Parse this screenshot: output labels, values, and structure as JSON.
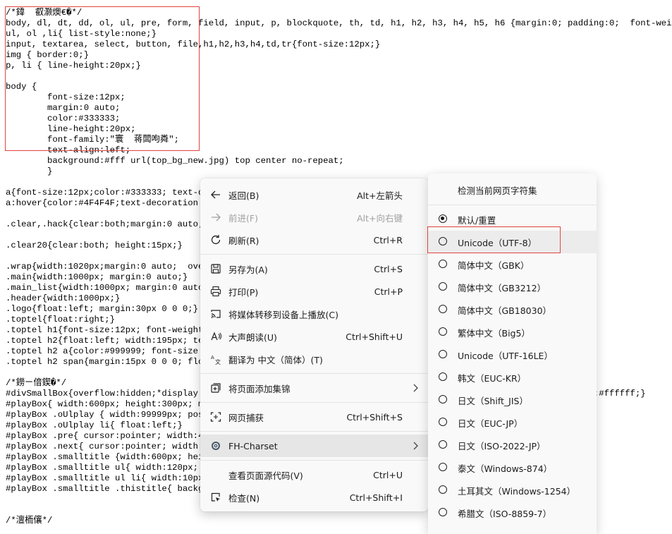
{
  "source_lines": [
    "/*鍏  叡灏燠€�*/",
    "body, dl, dt, dd, ol, ul, pre, form, field, input, p, blockquote, th, td, h1, h2, h3, h4, h5, h6 {margin:0; padding:0;  font-weight:",
    "ul, ol ,li{ list-style:none;}",
    "input, textarea, select, button, file,h1,h2,h3,h4,td,tr{font-size:12px;}",
    "img { border:0;}",
    "p, li { line-height:20px;}",
    "",
    "body {",
    "        font-size:12px;",
    "        margin:0 auto;",
    "        color:#333333;",
    "        line-height:20px;",
    "        font-family:\"寰  蒋闆呴粦\";",
    "        text-align:left;",
    "        background:#fff url(top_bg_new.jpg) top center no-repeat;",
    "        }",
    "",
    "a{font-size:12px;color:#333333; text-decoration:none;}",
    "a:hover{color:#4F4F4F;text-decoration: none;}",
    "",
    ".clear,.hack{clear:both;margin:0 auto;}",
    "",
    ".clear20{clear:both; height:15px;}",
    "",
    ".wrap{width:1020px;margin:0 auto;  overflow:hidden;}",
    ".main{width:1000px; margin:0 auto;}",
    ".main_list{width:1000px; margin:0 auto;background:#fff;}",
    ".header{width:1000px;}",
    ".logo{float:left; margin:30px 0 0 0;}",
    ".toptel{float:right;}",
    ".toptel h1{font-size:12px; font-weight:normal;}",
    ".toptel h2{float:left; width:195px; text-align:left;}",
    ".toptel h2 a{color:#999999; font-size:12px;}",
    ".toptel h2 span{margin:15px 0 0 0; float:left;}",
    "",
    "/*鐒ㄧ偣鍥�*/",
    "#divSmallBox{overflow:hidden;*display:inline;background:#fff;                                                    :#ffffff;}",
    "#playBox{ width:600px; height:300px; margin:0 auto; overflow:hidden;}",
    "#playBox .oUlplay { width:99999px; position:absolute; left:0; top:0;}",
    "#playBox .oUlplay li{ float:left;}",
    "#playBox .pre{ cursor:pointer; width:45px; height:45px;                                        left:10px; z-",
    "#playBox .next{ cursor:pointer; width:45px; height:45px;                                       right:10px;",
    "#playBox .smalltitle {width:600px; height:10px;}",
    "#playBox .smalltitle ul{ width:120px; margin:0 auto;}",
    "#playBox .smalltitle ul li{ width:10px; height:10px;                                          overflow:hidd",
    "#playBox .smalltitle .thistitle{ background:#fff;}",
    "",
    "",
    "/*澶栭儴*/"
  ],
  "context_menu": {
    "items": [
      {
        "label": "返回(B)",
        "shortcut": "Alt+左箭头",
        "icon": "back-arrow-icon",
        "disabled": false
      },
      {
        "label": "前进(F)",
        "shortcut": "Alt+向右键",
        "icon": "forward-arrow-icon",
        "disabled": true
      },
      {
        "label": "刷新(R)",
        "shortcut": "Ctrl+R",
        "icon": "refresh-icon",
        "disabled": false
      },
      {
        "label": "另存为(A)",
        "shortcut": "Ctrl+S",
        "icon": "save-as-icon",
        "disabled": false
      },
      {
        "label": "打印(P)",
        "shortcut": "Ctrl+P",
        "icon": "print-icon",
        "disabled": false
      },
      {
        "label": "将媒体转移到设备上播放(C)",
        "shortcut": "",
        "icon": "cast-icon",
        "disabled": false
      },
      {
        "label": "大声朗读(U)",
        "shortcut": "Ctrl+Shift+U",
        "icon": "read-aloud-icon",
        "disabled": false
      },
      {
        "label": "翻译为 中文（简体）(T)",
        "shortcut": "",
        "icon": "translate-icon",
        "disabled": false
      },
      {
        "label": "将页面添加集锦",
        "shortcut": "",
        "icon": "collections-icon",
        "disabled": false,
        "submenu": true
      },
      {
        "label": "网页捕获",
        "shortcut": "Ctrl+Shift+S",
        "icon": "web-capture-icon",
        "disabled": false
      },
      {
        "label": "FH-Charset",
        "shortcut": "",
        "icon": "extension-icon",
        "disabled": false,
        "submenu": true
      },
      {
        "label": "查看页面源代码(V)",
        "shortcut": "Ctrl+U",
        "icon": "",
        "disabled": false
      },
      {
        "label": "检查(N)",
        "shortcut": "Ctrl+Shift+I",
        "icon": "inspect-icon",
        "disabled": false
      }
    ]
  },
  "charset_menu": {
    "header": "检测当前网页字符集",
    "items": [
      {
        "label": "默认/重置",
        "selected": true
      },
      {
        "label": "Unicode（UTF-8）",
        "selected": false
      },
      {
        "label": "简体中文（GBK）",
        "selected": false
      },
      {
        "label": "简体中文（GB3212）",
        "selected": false
      },
      {
        "label": "简体中文（GB18030）",
        "selected": false
      },
      {
        "label": "繁体中文（Big5）",
        "selected": false
      },
      {
        "label": "Unicode（UTF-16LE）",
        "selected": false
      },
      {
        "label": "韩文（EUC-KR）",
        "selected": false
      },
      {
        "label": "日文（Shift_JIS）",
        "selected": false
      },
      {
        "label": "日文（EUC-JP）",
        "selected": false
      },
      {
        "label": "日文（ISO-2022-JP）",
        "selected": false
      },
      {
        "label": "泰文（Windows-874）",
        "selected": false
      },
      {
        "label": "土耳其文（Windows-1254）",
        "selected": false
      },
      {
        "label": "希腊文（ISO-8859-7）",
        "selected": false
      }
    ]
  },
  "colors": {
    "annotation_border": "#e0443e",
    "menu_bg": "#f9f9f9",
    "hover_bg": "#e6e6e6"
  }
}
